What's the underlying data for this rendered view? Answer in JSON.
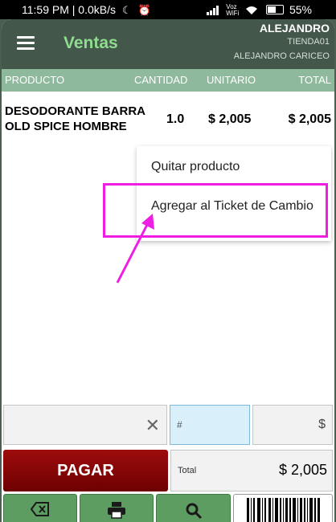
{
  "status_bar": {
    "time": "11:59 PM | 0.0kB/s",
    "network_label_top": "Voz",
    "network_label_bottom": "WiFi",
    "battery": "55%"
  },
  "header": {
    "menu_icon": "hamburger-icon",
    "title": "Ventas",
    "user_name": "ALEJANDRO",
    "store": "TIENDA01",
    "user_full_name": "ALEJANDRO CARICEO"
  },
  "table": {
    "columns": [
      "PRODUCTO",
      "CANTIDAD",
      "UNITARIO",
      "TOTAL"
    ],
    "rows": [
      {
        "product_line1": "DESODORANTE BARRA",
        "product_line2": "OLD SPICE HOMBRE",
        "quantity": "1.0",
        "unit_price": "$ 2,005",
        "total": "$ 2,005"
      }
    ]
  },
  "context_menu": {
    "items": [
      "Quitar producto",
      "Agregar al Ticket de Cambio"
    ],
    "highlight_color": "#ee1fe3"
  },
  "inputs": {
    "search_value": "",
    "quantity_placeholder": "#",
    "price_placeholder": "$"
  },
  "payment": {
    "pay_label": "PAGAR",
    "total_label": "Total",
    "total_value": "$ 2,005"
  },
  "bottom_buttons": {
    "icons": [
      "backspace-icon",
      "printer-icon",
      "search-icon",
      "barcode-icon"
    ]
  },
  "colors": {
    "app_bar": "#44574b",
    "title": "#8fdc8f",
    "table_header": "#8fb99c",
    "pay_button": "#8b0000",
    "bottom_button": "#5e9d62"
  }
}
